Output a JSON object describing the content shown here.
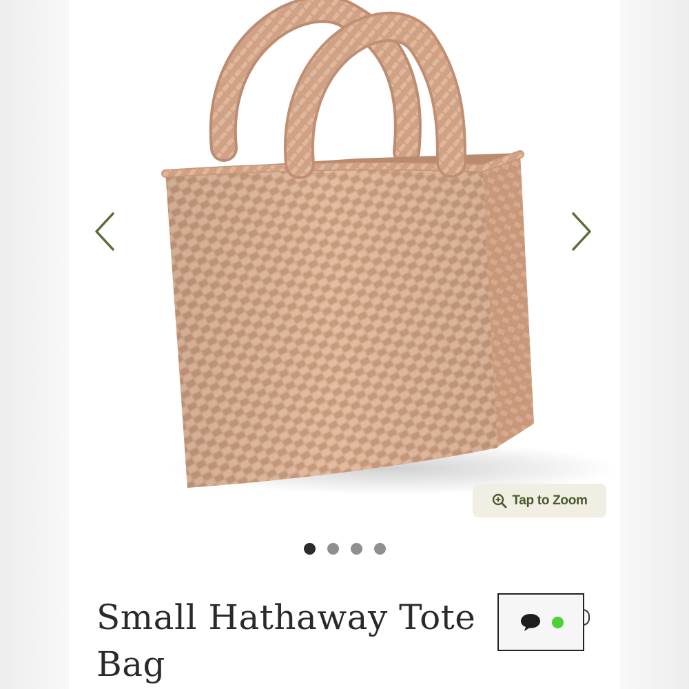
{
  "product": {
    "title": "Small Hathaway Tote Bag",
    "image_subject": "woven tote bag, tan"
  },
  "gallery": {
    "slide_count": 4,
    "active_index": 0,
    "zoom_label": "Tap to Zoom"
  },
  "colors": {
    "accent": "#4a5a2e",
    "arrow": "#5a6b35",
    "pill_background": "#f1eee3",
    "dot_active": "#2b2b2b",
    "dot_inactive": "#8f8f8f",
    "online": "#4cd137",
    "bag": "#d9ae91"
  },
  "icons": {
    "prev": "chevron-left-icon",
    "next": "chevron-right-icon",
    "zoom": "zoom-in-icon",
    "chat": "chat-bubble-icon"
  }
}
